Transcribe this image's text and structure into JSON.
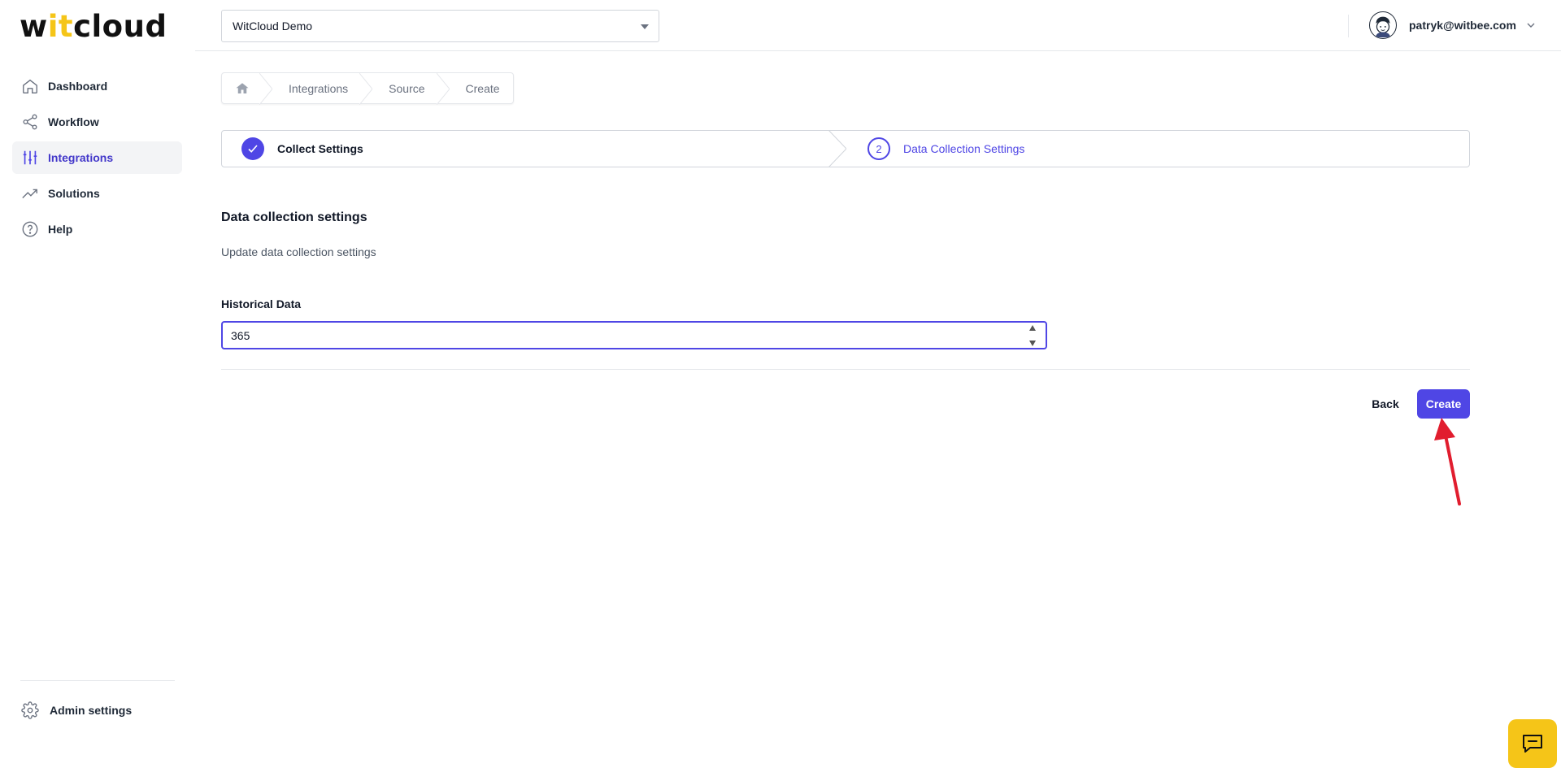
{
  "app": {
    "logo_text_1": "w",
    "logo_text_accent": "it",
    "logo_text_2": "cloud"
  },
  "sidebar": {
    "items": [
      {
        "label": "Dashboard",
        "icon": "home-icon",
        "active": false
      },
      {
        "label": "Workflow",
        "icon": "share-icon",
        "active": false
      },
      {
        "label": "Integrations",
        "icon": "sliders-icon",
        "active": true
      },
      {
        "label": "Solutions",
        "icon": "trending-up-icon",
        "active": false
      },
      {
        "label": "Help",
        "icon": "help-circle-icon",
        "active": false
      }
    ],
    "admin_label": "Admin settings"
  },
  "topbar": {
    "org_selected": "WitCloud Demo",
    "user_email": "patryk@witbee.com"
  },
  "breadcrumb": {
    "items": [
      "Integrations",
      "Source",
      "Create"
    ]
  },
  "stepper": {
    "step1_label": "Collect Settings",
    "step2_number": "2",
    "step2_label": "Data Collection Settings"
  },
  "form": {
    "title": "Data collection settings",
    "description": "Update data collection settings",
    "field_label": "Historical Data",
    "field_value": "365"
  },
  "actions": {
    "back_label": "Back",
    "create_label": "Create"
  },
  "colors": {
    "accent": "#4f46e5",
    "brand_yellow": "#f5c518",
    "annotation_red": "#e11d2e"
  }
}
